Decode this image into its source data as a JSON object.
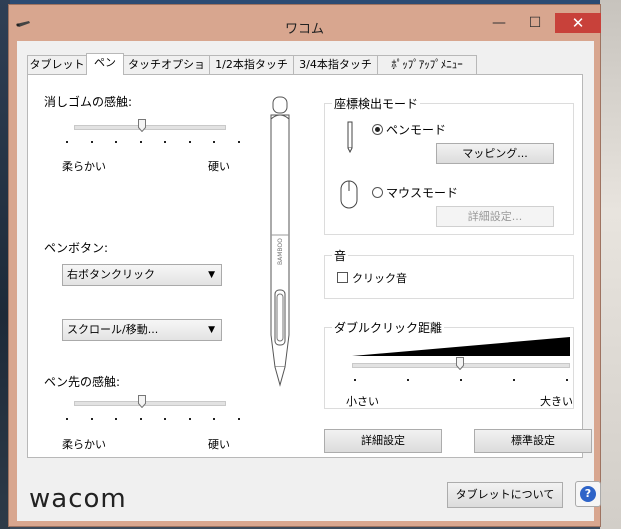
{
  "window": {
    "title": "ワコム"
  },
  "tabs": [
    {
      "label": "タブレット"
    },
    {
      "label": "ペン"
    },
    {
      "label": "タッチオプション"
    },
    {
      "label": "1/2本指タッチ"
    },
    {
      "label": "3/4本指タッチ"
    },
    {
      "label": "ﾎﾟｯﾌﾟｱｯﾌﾟﾒﾆｭｰ"
    }
  ],
  "left": {
    "eraser_label": "消しゴムの感触:",
    "eraser_level": 0.45,
    "soft_label": "柔らかい",
    "hard_label": "硬い",
    "pen_button_label": "ペンボタン:",
    "pen_button_value": "右ボタンクリック",
    "scroll_value": "スクロール/移動...",
    "tip_label": "ペン先の感触:",
    "tip_level": 0.45,
    "tip_soft_label": "柔らかい",
    "tip_hard_label": "硬い"
  },
  "pen_image": {
    "brand": "BAMBOO"
  },
  "coord": {
    "title": "座標検出モード",
    "pen_mode_label": "ペンモード",
    "pen_mode_selected": true,
    "mapping_button": "マッピング...",
    "mouse_mode_label": "マウスモード",
    "detail_button": "詳細設定..."
  },
  "sound": {
    "title": "音",
    "click_sound_label": "クリック音",
    "checked": false
  },
  "double_click": {
    "title": "ダブルクリック距離",
    "small_label": "小さい",
    "large_label": "大きい",
    "level": 0.5
  },
  "bottom": {
    "advanced_button": "詳細設定",
    "default_button": "標準設定",
    "about_button": "タブレットについて",
    "logo_text": "wacom"
  },
  "colors": {
    "titlebar": "#d8a68f",
    "close": "#c8413a",
    "help": "#2e64c8"
  }
}
